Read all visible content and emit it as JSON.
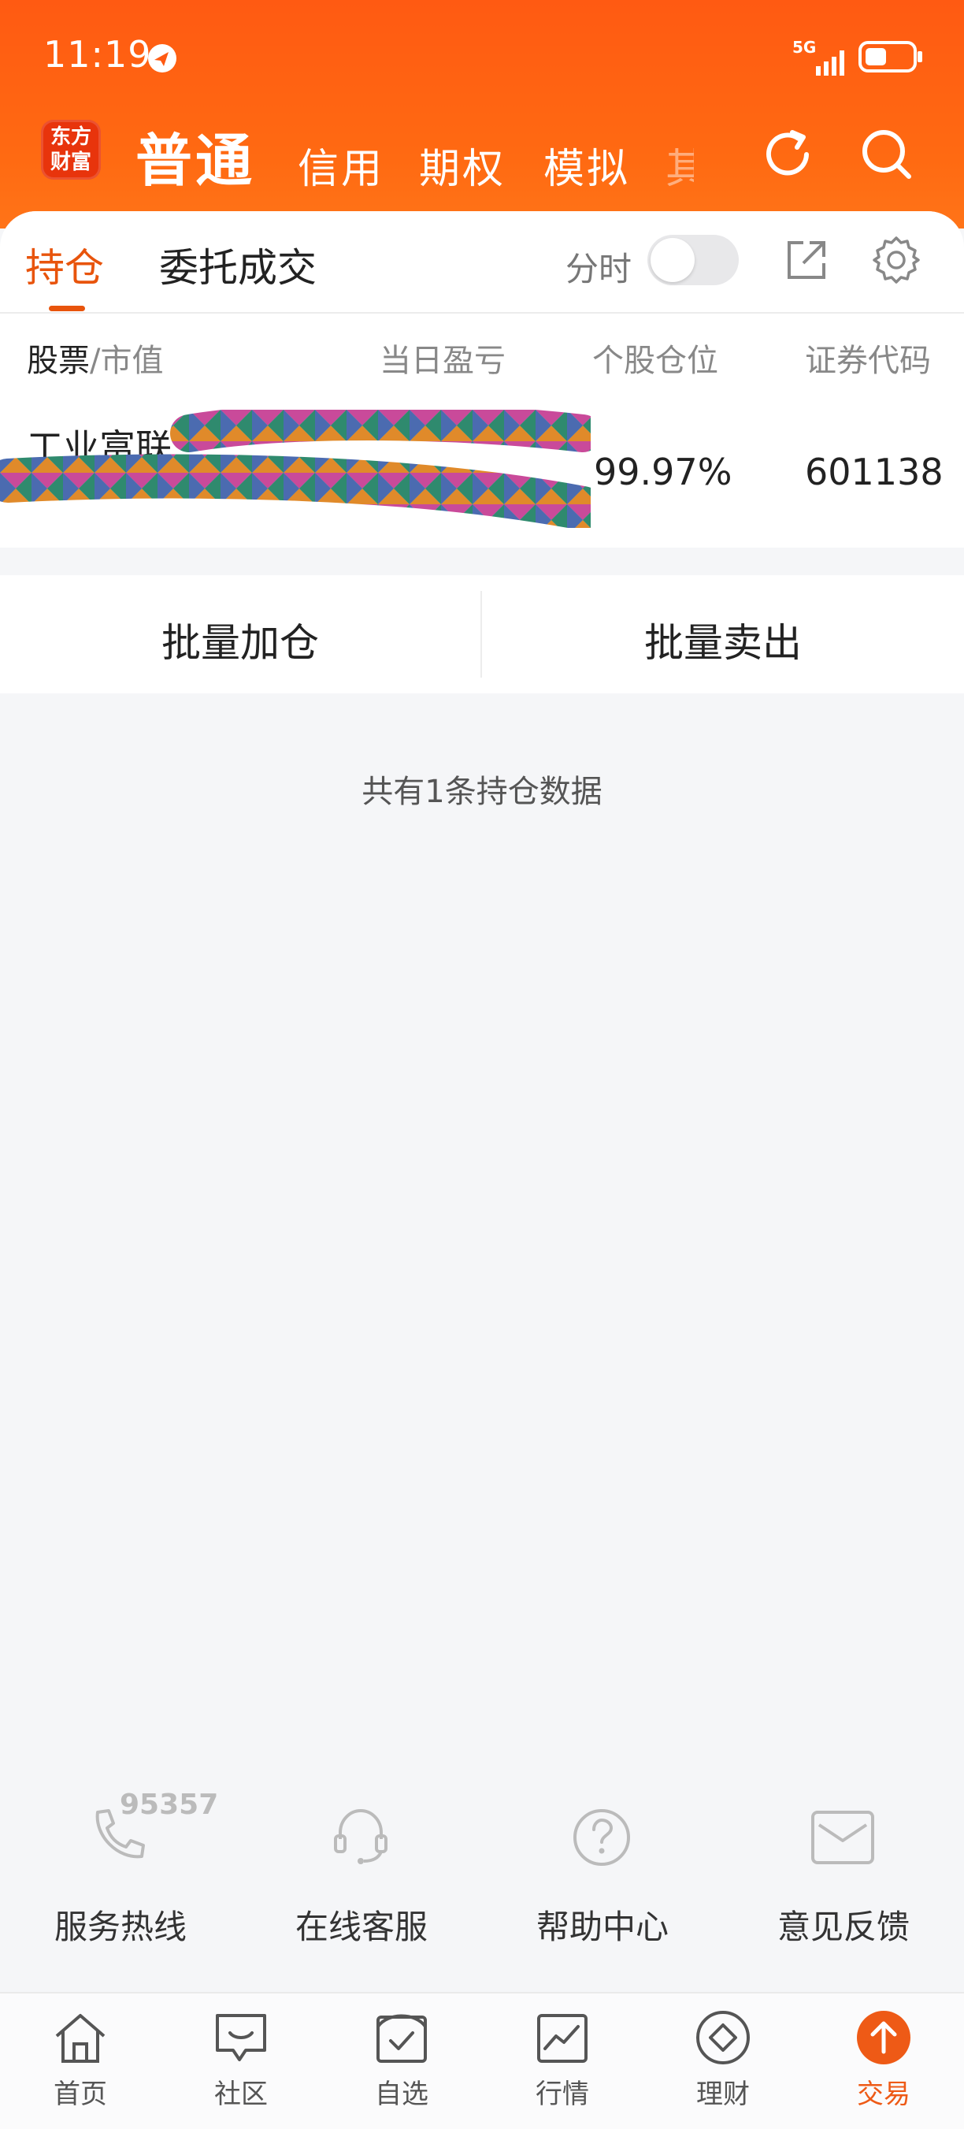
{
  "status_bar": {
    "time": "11:19",
    "network": "5G"
  },
  "header": {
    "logo_line1": "东方",
    "logo_line2": "财富",
    "tabs": [
      {
        "label": "普通",
        "active": true
      },
      {
        "label": "信用"
      },
      {
        "label": "期权"
      },
      {
        "label": "模拟"
      },
      {
        "label": "其"
      }
    ]
  },
  "subtabs": {
    "holdings": "持仓",
    "orders": "委托成交",
    "intraday_label": "分时",
    "intraday_on": false
  },
  "columns": {
    "stock": "股票",
    "separator": "/",
    "market_value": "市值",
    "daily_pnl": "当日盈亏",
    "position_ratio": "个股仓位",
    "code": "证券代码"
  },
  "holdings": [
    {
      "name": "工业富联",
      "position_ratio": "99.97%",
      "code": "601138"
    }
  ],
  "actions": {
    "batch_add": "批量加仓",
    "batch_sell": "批量卖出"
  },
  "summary": "共有1条持仓数据",
  "support": {
    "hotline_number": "95357",
    "items": [
      {
        "label": "服务热线",
        "icon": "phone-icon"
      },
      {
        "label": "在线客服",
        "icon": "headset-icon"
      },
      {
        "label": "帮助中心",
        "icon": "question-icon"
      },
      {
        "label": "意见反馈",
        "icon": "mail-icon"
      }
    ]
  },
  "bottom_nav": [
    {
      "label": "首页",
      "icon": "home-icon"
    },
    {
      "label": "社区",
      "icon": "chat-icon"
    },
    {
      "label": "自选",
      "icon": "watchlist-icon"
    },
    {
      "label": "行情",
      "icon": "chart-icon"
    },
    {
      "label": "理财",
      "icon": "diamond-icon"
    },
    {
      "label": "交易",
      "icon": "trade-arrow-icon",
      "active": true
    }
  ],
  "colors": {
    "brand": "#ff5a12",
    "accent": "#e8540c",
    "background": "#f5f6f8"
  }
}
